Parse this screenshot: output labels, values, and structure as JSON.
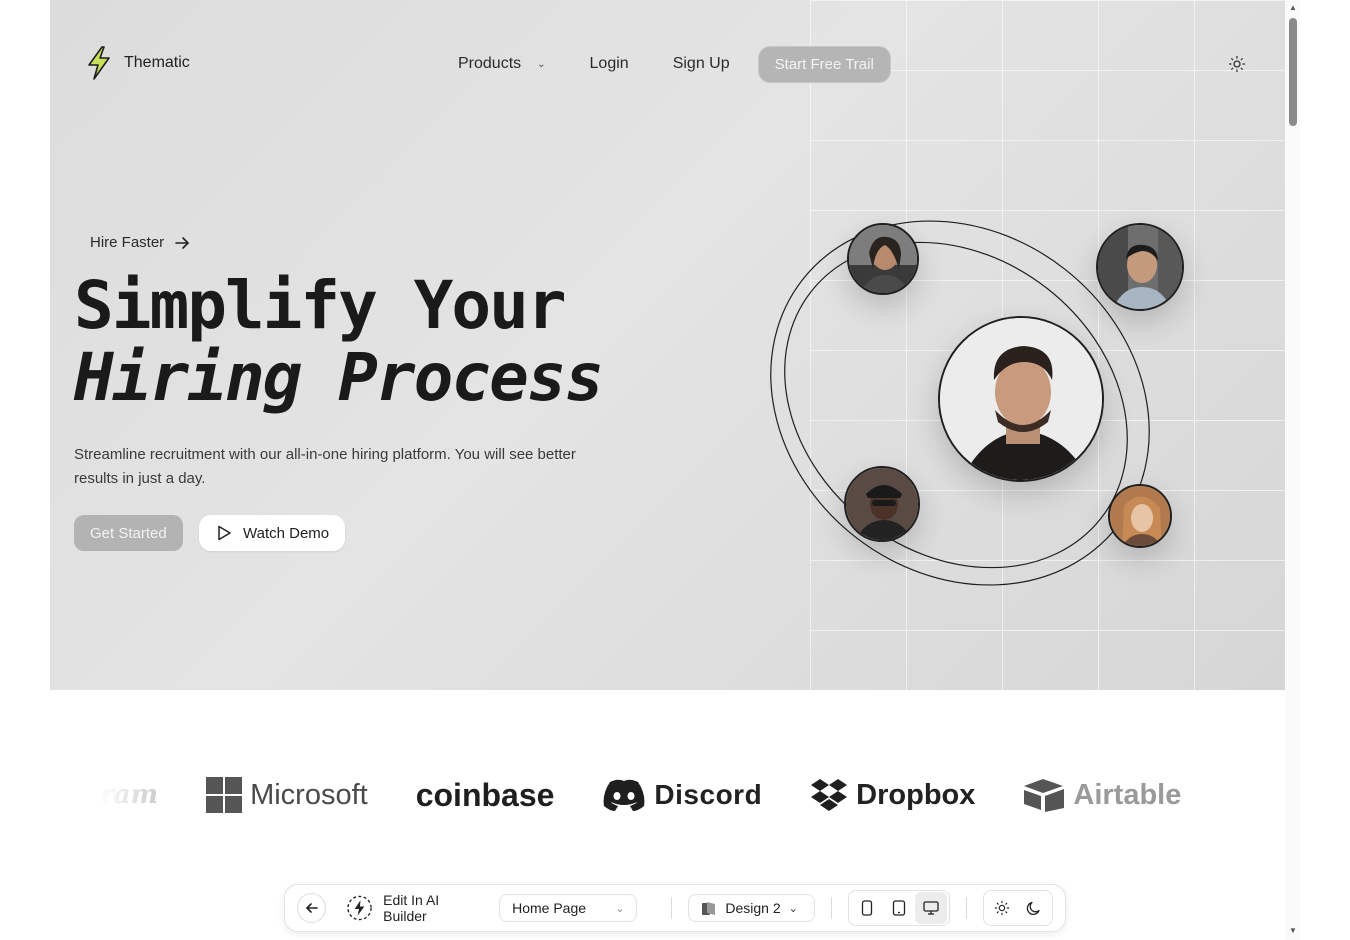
{
  "header": {
    "brand": "Thematic",
    "nav": {
      "products": "Products",
      "login": "Login",
      "signup": "Sign Up",
      "cta": "Start Free Trail"
    },
    "theme_icon": "sun-icon"
  },
  "hero": {
    "tagline": "Hire Faster",
    "title_line1": "Simplify Your",
    "title_line2": "Hiring Process",
    "subtitle": "Streamline recruitment with our all-in-one hiring platform. You will see better results in just a day.",
    "primary_button": "Get Started",
    "secondary_button": "Watch Demo"
  },
  "logos": {
    "partial": "ram",
    "brands": [
      "Microsoft",
      "coinbase",
      "Discord",
      "Dropbox",
      "Airtable"
    ]
  },
  "toolbar": {
    "ai_builder": "Edit In AI Builder",
    "page_select": "Home Page",
    "design_select": "Design 2",
    "devices": [
      "mobile-icon",
      "tablet-icon",
      "desktop-icon"
    ],
    "active_device": "desktop-icon",
    "themes": [
      "sun-icon",
      "moon-icon"
    ]
  },
  "colors": {
    "hero_bg": "#dcdcdc",
    "button_muted": "#b3b3b3",
    "logo_accent": "#c8e05a"
  }
}
